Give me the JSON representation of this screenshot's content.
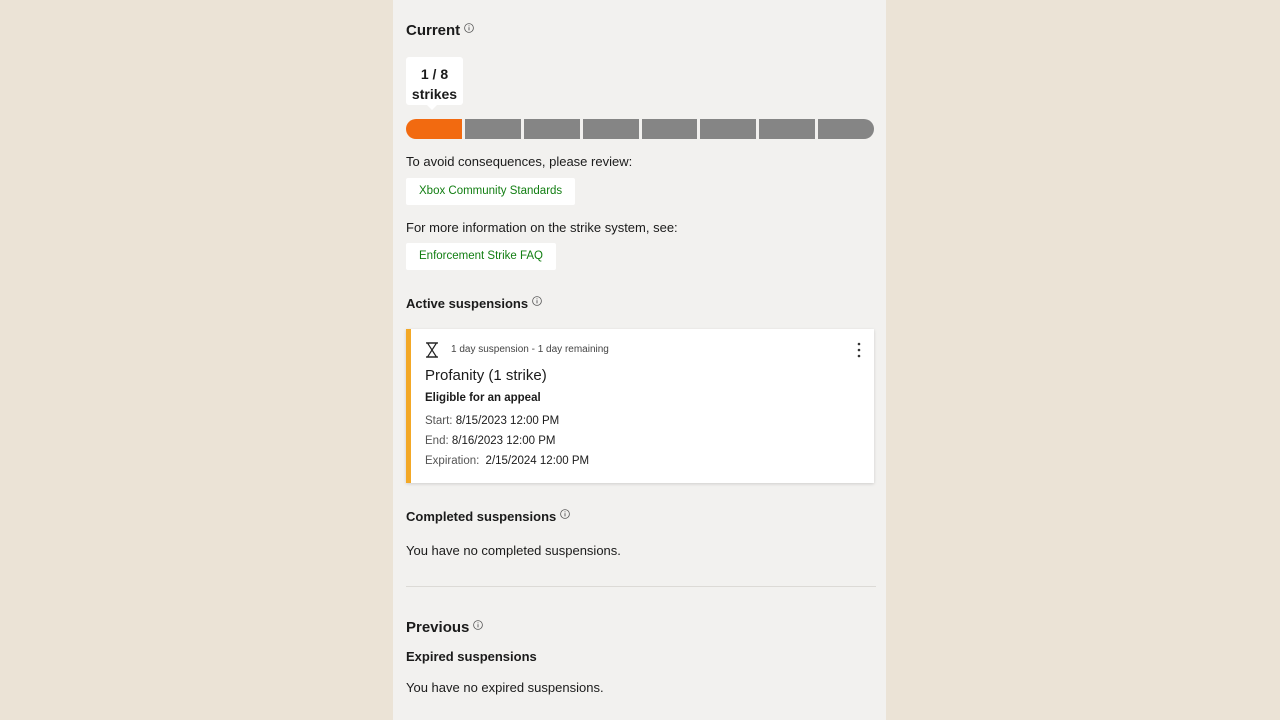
{
  "current": {
    "heading": "Current",
    "strikes_count": "1 / 8",
    "strikes_word": "strikes",
    "strikes_filled": 1,
    "strikes_total": 8
  },
  "review": {
    "prompt": "To avoid consequences, please review:",
    "link_label": "Xbox Community Standards"
  },
  "info": {
    "prompt": "For more information on the strike system, see:",
    "link_label": "Enforcement Strike FAQ"
  },
  "active": {
    "heading": "Active suspensions",
    "card": {
      "meta": "1 day suspension - 1 day remaining",
      "reason": "Profanity (1 strike)",
      "appeal": "Eligible for an appeal",
      "start_label": "Start:",
      "start_value": "8/15/2023 12:00 PM",
      "end_label": "End:",
      "end_value": "8/16/2023 12:00 PM",
      "expiration_label": "Expiration:",
      "expiration_value": "2/15/2024 12:00 PM"
    }
  },
  "completed": {
    "heading": "Completed suspensions",
    "empty": "You have no completed suspensions."
  },
  "previous": {
    "heading": "Previous",
    "subheading": "Expired suspensions",
    "empty": "You have no expired suspensions."
  },
  "colors": {
    "strike_filled": "#f26a10",
    "strike_empty": "#858585",
    "card_accent": "#f3a826",
    "link": "#127e12"
  }
}
